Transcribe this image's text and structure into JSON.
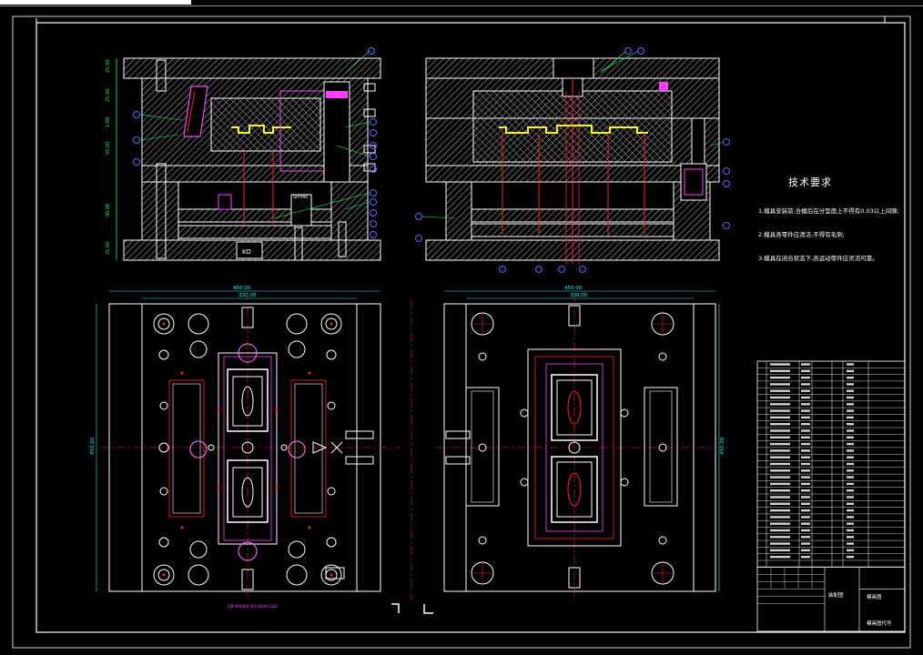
{
  "tech_requirements": {
    "title": "技术要求",
    "items": [
      "1.模具安装前,合模后在分型面上不得有0.03以上间隙;",
      "2.模具各零件应清洁,不得有毛刺;",
      "3.模具在闭合状态下,各运动零件应灵活可靠。"
    ]
  },
  "dims": {
    "top_left_width": "450.00",
    "top_left_inner": "330.00",
    "top_right_width": "450.00",
    "top_right_inner": "330.00",
    "left_height": "450.00",
    "right_height": "450.00",
    "bottom_note": "GB-M0000-A0-0000-C00"
  },
  "bom": {
    "rows": 31,
    "title_cells": [
      "装配图",
      "模具图",
      "模具图代号"
    ]
  },
  "colors": {
    "bg": "#000000",
    "line": "#ffffff",
    "hatch": "#c8c8c8",
    "red": "#ff2020",
    "magenta": "#ff40ff",
    "yellow": "#ffff00",
    "cyan": "#00ffff",
    "green": "#00ff60",
    "blue": "#4060ff",
    "dark_red": "#a00000"
  }
}
